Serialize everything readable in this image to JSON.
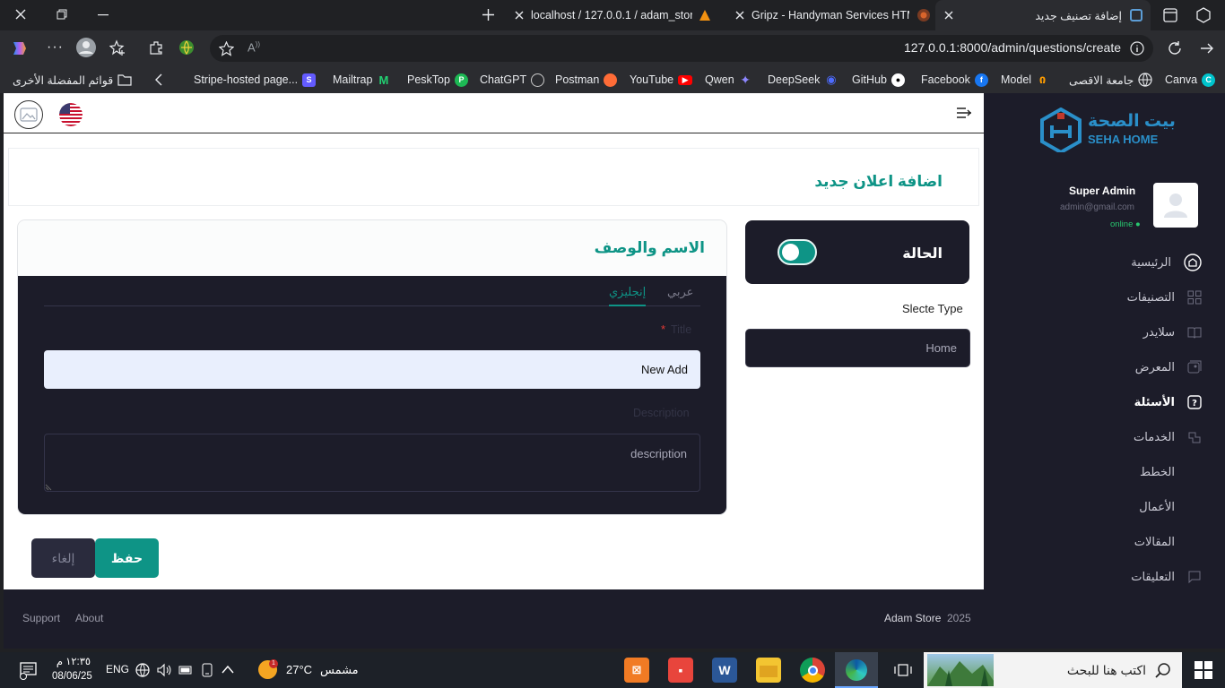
{
  "browser": {
    "tabs": [
      {
        "title": "localhost / 127.0.0.1 / adam_store"
      },
      {
        "title": "Gripz - Handyman Services HTML"
      },
      {
        "title": "إضافة تصنيف جديد"
      }
    ],
    "url": "127.0.0.1:8000/admin/questions/create",
    "bookmarks": [
      {
        "label": "Canva",
        "icon": "canva-icon",
        "color": "#00c4cc"
      },
      {
        "label": "جامعة الاقصى",
        "icon": "globe-icon",
        "color": "#9aa0a6"
      },
      {
        "label": "Model",
        "icon": "huggingface-icon",
        "color": "#ff9d00"
      },
      {
        "label": "Facebook",
        "icon": "facebook-icon",
        "color": "#1877f2"
      },
      {
        "label": "GitHub",
        "icon": "github-icon",
        "color": "#ffffff"
      },
      {
        "label": "DeepSeek",
        "icon": "deepseek-icon",
        "color": "#4d6bfe"
      },
      {
        "label": "Qwen",
        "icon": "qwen-icon",
        "color": "#615ced"
      },
      {
        "label": "YouTube",
        "icon": "youtube-icon",
        "color": "#ff0000"
      },
      {
        "label": "Postman",
        "icon": "postman-icon",
        "color": "#ff6c37"
      },
      {
        "label": "ChatGPT",
        "icon": "chatgpt-icon",
        "color": "#cccccc"
      },
      {
        "label": "PeskTop",
        "icon": "pesktop-icon",
        "color": "#1db954"
      },
      {
        "label": "Mailtrap",
        "icon": "mailtrap-icon",
        "color": "#22d172"
      },
      {
        "label": "Stripe-hosted page...",
        "icon": "stripe-icon",
        "color": "#635bff"
      }
    ],
    "other_favorites": "قوائم المفضلة الأخرى"
  },
  "sidebar": {
    "brand_ar": "بيت الصحة",
    "brand_en": "SEHA HOME",
    "user_name": "Super Admin",
    "user_email": "admin@gmail.com",
    "user_status": "online",
    "items": [
      {
        "label": "الرئيسية",
        "icon": "home-icon"
      },
      {
        "label": "التصنيفات",
        "icon": "grid-icon"
      },
      {
        "label": "سلايدر",
        "icon": "book-icon"
      },
      {
        "label": "المعرض",
        "icon": "gallery-icon"
      },
      {
        "label": "الأسئلة",
        "icon": "question-icon"
      },
      {
        "label": "الخدمات",
        "icon": "services-icon"
      },
      {
        "label": "الخطط",
        "icon": "plans-icon"
      },
      {
        "label": "الأعمال",
        "icon": "works-icon"
      },
      {
        "label": "المقالات",
        "icon": "articles-icon"
      },
      {
        "label": "التعليقات",
        "icon": "comments-icon"
      }
    ]
  },
  "page": {
    "title": "اضافة اعلان جديد",
    "status_label": "الحالة",
    "status_on": true,
    "type_label": "Slecte Type",
    "type_value": "Home",
    "card_title": "الاسم والوصف",
    "lang_tabs": [
      "عربي",
      "إنجليزي"
    ],
    "active_lang": "إنجليزي",
    "title_field_label": "Title",
    "required_mark": "*",
    "title_value": "New Add",
    "description_label": "Description",
    "description_placeholder": "description",
    "save_label": "حفظ",
    "cancel_label": "إلغاء"
  },
  "footer": {
    "year": "2025",
    "brand": "Adam Store",
    "links": [
      "About",
      "Support"
    ]
  },
  "taskbar": {
    "search_placeholder": "اكتب هنا للبحث",
    "weather_temp": "27°C",
    "weather_text": "مشمس",
    "weather_badge": "1",
    "lang": "ENG",
    "time": "١٢:٣٥ م",
    "date": "08/06/25"
  },
  "colors": {
    "accent": "#0e9486",
    "sidebar_bg": "#1c1c29",
    "required": "#e53935"
  }
}
